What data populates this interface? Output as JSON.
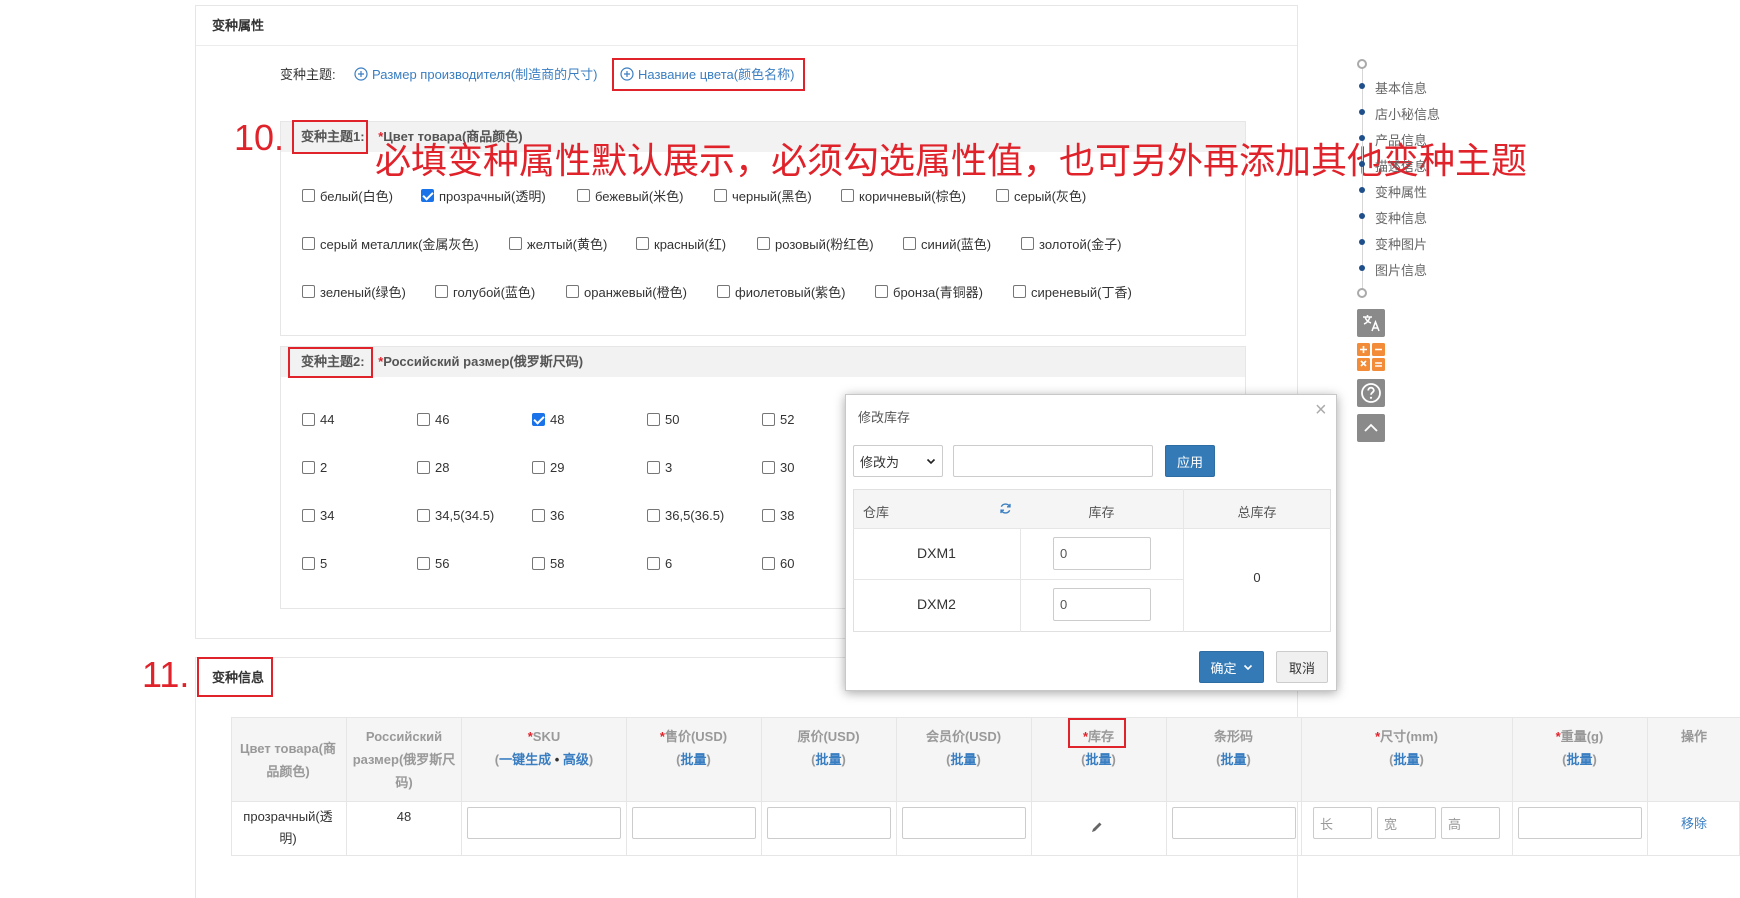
{
  "variant_attr": {
    "title": "变种属性",
    "theme_label": "变种主题:",
    "theme_options": [
      "Размер производителя(制造商的尺寸)",
      "Название цвета(颜色名称)"
    ],
    "group1": {
      "label": "变种主题1:",
      "required": "*",
      "name": "Цвет товара(商品颜色)",
      "rows": [
        [
          {
            "label": "белый(白色)",
            "checked": false
          },
          {
            "label": "прозрачный(透明)",
            "checked": true
          },
          {
            "label": "бежевый(米色)",
            "checked": false
          },
          {
            "label": "черный(黑色)",
            "checked": false
          },
          {
            "label": "коричневый(棕色)",
            "checked": false
          },
          {
            "label": "серый(灰色)",
            "checked": false
          }
        ],
        [
          {
            "label": "серый металлик(金属灰色)",
            "checked": false
          },
          {
            "label": "желтый(黄色)",
            "checked": false
          },
          {
            "label": "красный(红)",
            "checked": false
          },
          {
            "label": "розовый(粉红色)",
            "checked": false
          },
          {
            "label": "синий(蓝色)",
            "checked": false
          },
          {
            "label": "золотой(金子)",
            "checked": false
          }
        ],
        [
          {
            "label": "зеленый(绿色)",
            "checked": false
          },
          {
            "label": "голубой(蓝色)",
            "checked": false
          },
          {
            "label": "оранжевый(橙色)",
            "checked": false
          },
          {
            "label": "фиолетовый(紫色)",
            "checked": false
          },
          {
            "label": "бронза(青铜器)",
            "checked": false
          },
          {
            "label": "сиреневый(丁香)",
            "checked": false
          }
        ]
      ]
    },
    "group2": {
      "label": "变种主题2:",
      "required": "*",
      "name": "Российский размер(俄罗斯尺码)",
      "rows": [
        [
          {
            "label": "44",
            "checked": false
          },
          {
            "label": "46",
            "checked": false
          },
          {
            "label": "48",
            "checked": true
          },
          {
            "label": "50",
            "checked": false
          },
          {
            "label": "52",
            "checked": false
          }
        ],
        [
          {
            "label": "2",
            "checked": false
          },
          {
            "label": "28",
            "checked": false
          },
          {
            "label": "29",
            "checked": false
          },
          {
            "label": "3",
            "checked": false
          },
          {
            "label": "30",
            "checked": false
          }
        ],
        [
          {
            "label": "34",
            "checked": false
          },
          {
            "label": "34,5(34.5)",
            "checked": false
          },
          {
            "label": "36",
            "checked": false
          },
          {
            "label": "36,5(36.5)",
            "checked": false
          },
          {
            "label": "38",
            "checked": false
          }
        ],
        [
          {
            "label": "5",
            "checked": false
          },
          {
            "label": "56",
            "checked": false
          },
          {
            "label": "58",
            "checked": false
          },
          {
            "label": "6",
            "checked": false
          },
          {
            "label": "60",
            "checked": false
          }
        ]
      ]
    }
  },
  "annotations": {
    "num10": "10.",
    "num11": "11.",
    "note": "必填变种属性默认展示，必须勾选属性值，也可另外再添加其他变种主题"
  },
  "side_nav": {
    "items": [
      "基本信息",
      "店小秘信息",
      "产品信息",
      "描述信息",
      "变种属性",
      "变种信息",
      "变种图片",
      "图片信息"
    ]
  },
  "modal": {
    "title": "修改库存",
    "close": "×",
    "mode_select": "修改为",
    "value_input": "",
    "apply": "应用",
    "col_warehouse": "仓库",
    "col_stock": "库存",
    "col_total": "总库存",
    "rows": [
      {
        "warehouse": "DXM1",
        "stock": "0"
      },
      {
        "warehouse": "DXM2",
        "stock": "0"
      }
    ],
    "total": "0",
    "confirm": "确定",
    "cancel": "取消"
  },
  "variant_info": {
    "title": "变种信息",
    "headers": {
      "color": "Цвет товара(商品颜色)",
      "size": "Российский размер(俄罗斯尺码)",
      "sku": "SKU",
      "sku_gen": "一键生成",
      "sku_sep": "•",
      "sku_adv": "高级",
      "price": "售价(USD)",
      "orig_price": "原价(USD)",
      "member_price": "会员价(USD)",
      "stock": "库存",
      "barcode": "条形码",
      "dimension": "尺寸(mm)",
      "weight": "重量(g)",
      "action": "操作",
      "batch": "批量",
      "req": "*",
      "open_paren": "(",
      "close_paren": ")"
    },
    "row": {
      "color": "прозрачный(透明)",
      "size": "48",
      "len_ph": "长",
      "wid_ph": "宽",
      "hei_ph": "高",
      "remove": "移除"
    }
  }
}
